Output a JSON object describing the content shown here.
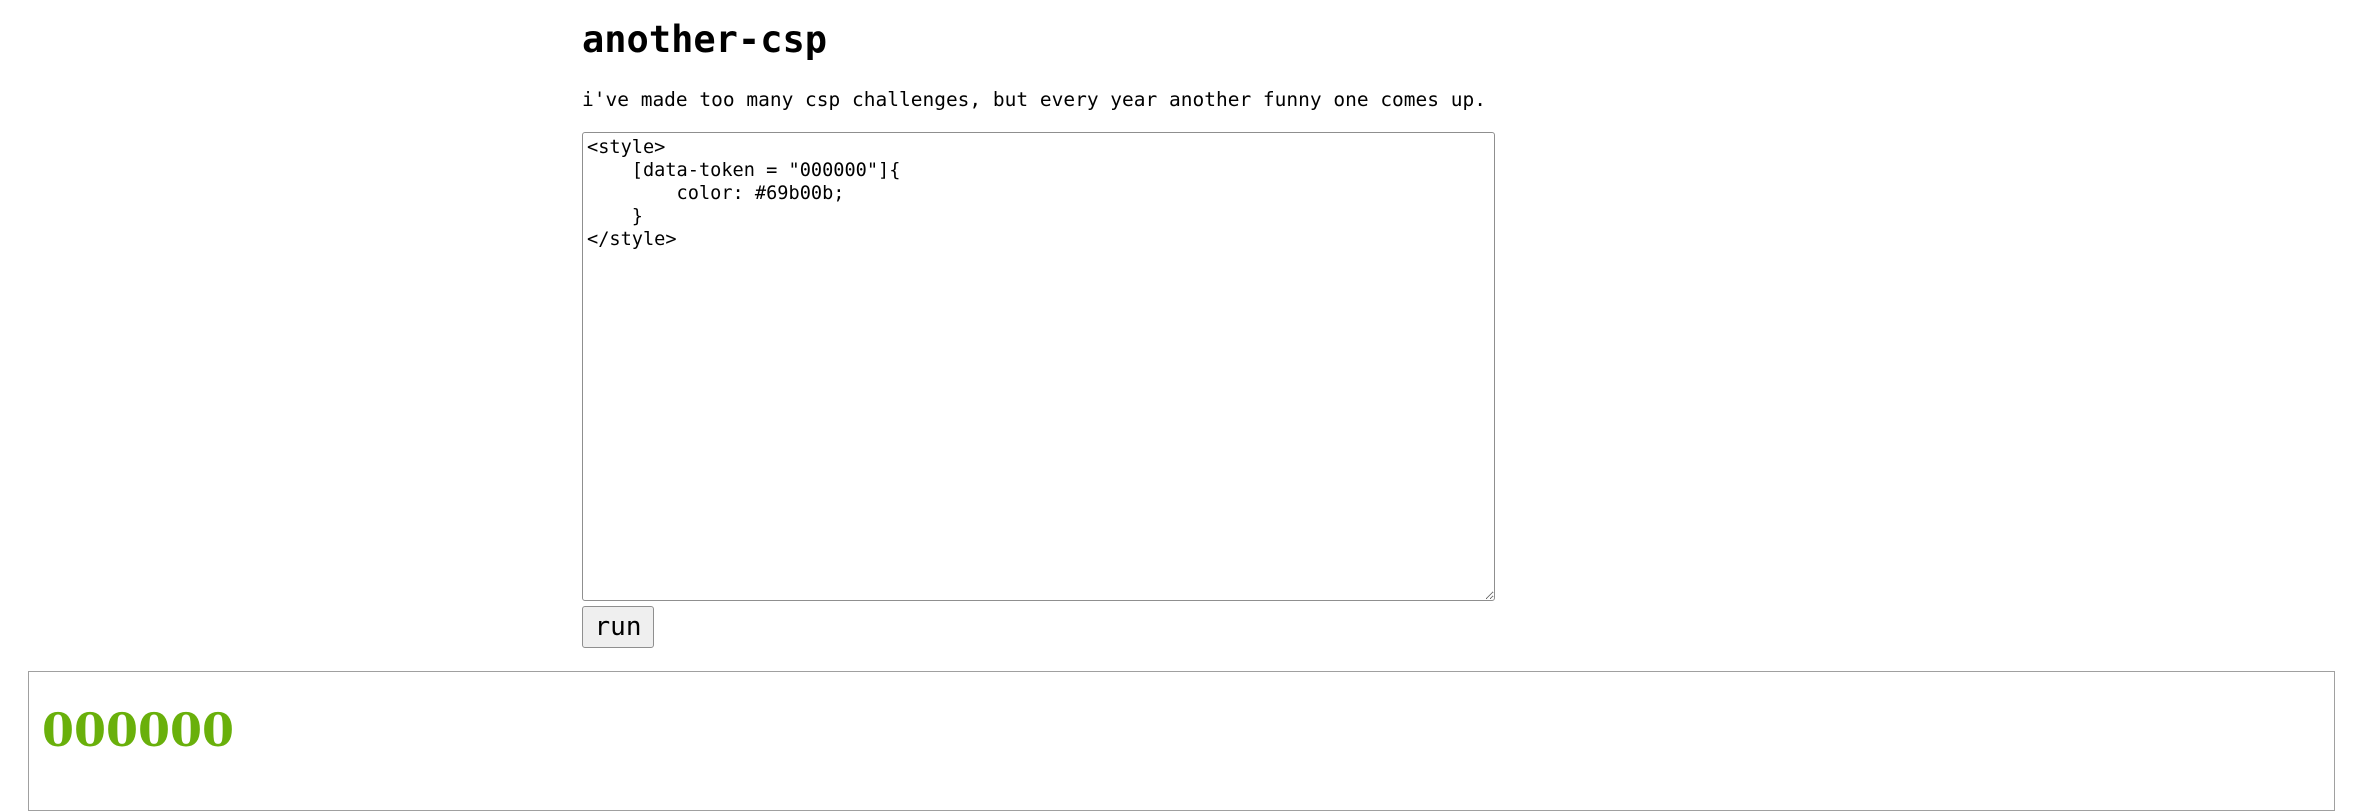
{
  "page": {
    "title": "another-csp",
    "description": "i've made too many csp challenges, but every year another funny one comes up."
  },
  "editor": {
    "value": "<style>\n    [data-token = \"000000\"]{\n        color: #69b00b;\n    }\n</style>"
  },
  "run_button": {
    "label": "run"
  },
  "preview": {
    "token_text": "000000",
    "token_color": "#69b00b"
  }
}
